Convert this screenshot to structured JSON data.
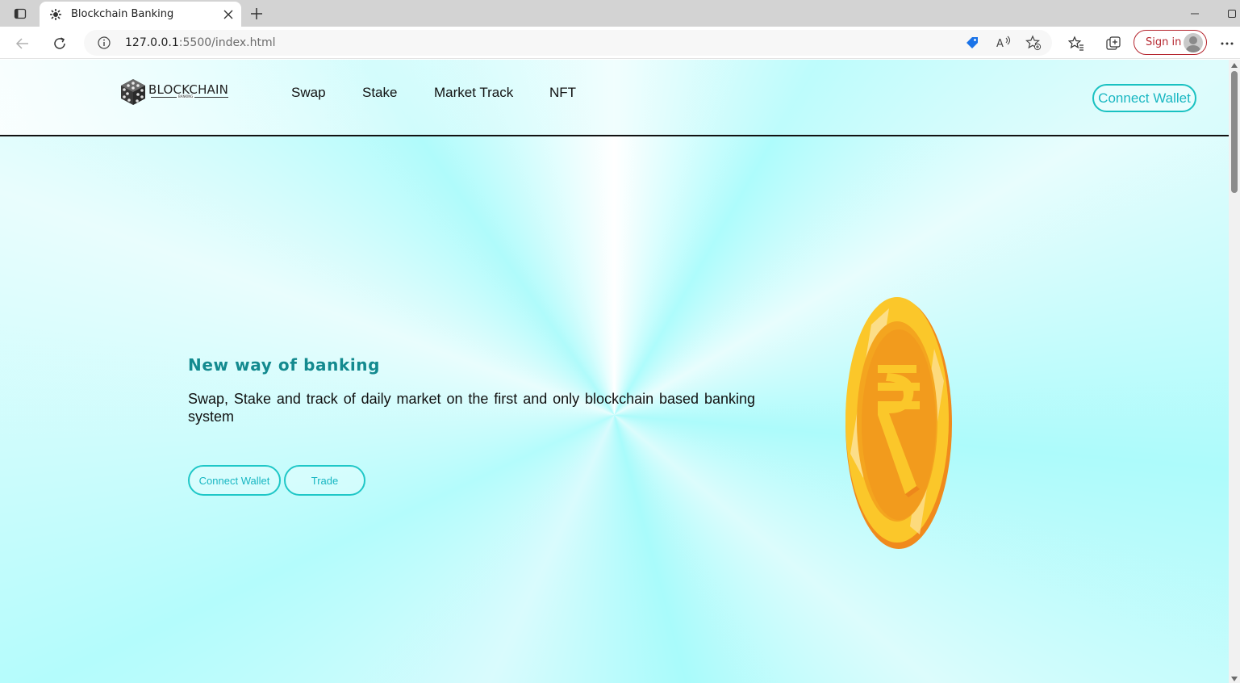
{
  "browser": {
    "tab_title": "Blockchain Banking",
    "url_host": "127.0.0.1",
    "url_rest": ":5500/index.html",
    "signin_label": "Sign in",
    "icons": [
      "tab-actions-icon",
      "tab-favicon-icon",
      "close-icon",
      "plus-icon",
      "minimize-icon",
      "maximize-icon",
      "back-icon",
      "refresh-icon",
      "info-icon",
      "shopping-tag-icon",
      "read-aloud-icon",
      "add-favorite-icon",
      "favorites-icon",
      "collections-icon",
      "more-icon"
    ]
  },
  "site": {
    "logo_text": "BLOCKCHAIN",
    "logo_sub": "BANKING",
    "nav": [
      "Swap",
      "Stake",
      "Market Track",
      "NFT"
    ],
    "header_button": "Connect Wallet",
    "hero": {
      "title": "New way of banking",
      "description": "Swap, Stake and track of daily market on the first and only blockchain based banking system",
      "primary_button": "Connect Wallet",
      "secondary_button": "Trade"
    },
    "colors": {
      "accent": "#19c1c1",
      "title": "#138a8f",
      "coin_gold": "#f7b21b",
      "coin_orange": "#f08a1c"
    }
  }
}
